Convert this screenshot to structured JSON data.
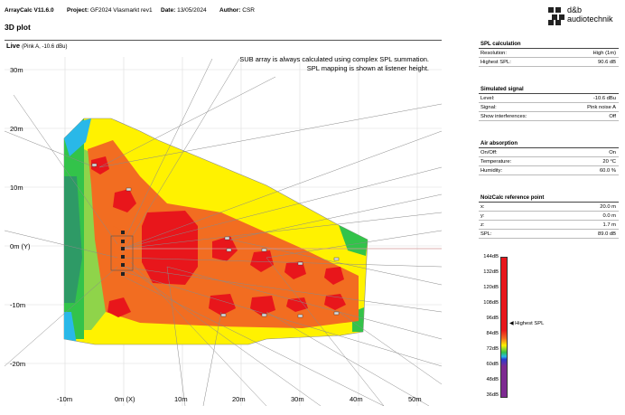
{
  "header": {
    "app": "ArrayCalc V11.6.0",
    "project_label": "Project:",
    "project": "GF2024 Vlasmarkt rev1",
    "date_label": "Date:",
    "date": "13/05/2024",
    "author_label": "Author:",
    "author": "CSR",
    "logo_line1": "d&b",
    "logo_line2": "audiotechnik"
  },
  "plot": {
    "title": "3D plot",
    "live_label": "Live",
    "live_sub": "(Pink A, -10.6 dBu)",
    "note_line1": "SUB array is always calculated using complex SPL summation.",
    "note_line2": "SPL mapping is shown at listener height.",
    "y_ticks": [
      "30m",
      "20m",
      "10m",
      "0m (Y)",
      "-10m",
      "-20m"
    ],
    "x_ticks": [
      "-10m",
      "0m (X)",
      "10m",
      "20m",
      "30m",
      "40m",
      "50m"
    ]
  },
  "panels": [
    {
      "title": "SPL calculation",
      "rows": [
        {
          "label": "Resolution:",
          "value": "High (1m)"
        },
        {
          "label": "Highest SPL:",
          "value": "90.6 dB"
        }
      ]
    },
    {
      "title": "Simulated signal",
      "rows": [
        {
          "label": "Level:",
          "value": "-10.6 dBu"
        },
        {
          "label": "Signal:",
          "value": "Pink noise A"
        },
        {
          "label": "Show interferences:",
          "value": "Off"
        }
      ]
    },
    {
      "title": "Air absorption",
      "rows": [
        {
          "label": "On/Off:",
          "value": "On"
        },
        {
          "label": "Temperature:",
          "value": "20 °C"
        },
        {
          "label": "Humidity:",
          "value": "60.0 %"
        }
      ]
    },
    {
      "title": "NoizCalc reference point",
      "rows": [
        {
          "label": "x:",
          "value": "20.0 m"
        },
        {
          "label": "y:",
          "value": "0.0 m"
        },
        {
          "label": "z:",
          "value": "1.7 m"
        },
        {
          "label": "SPL:",
          "value": "89.0 dB"
        }
      ]
    }
  ],
  "scale": {
    "ticks": [
      "144dB",
      "132dB",
      "120dB",
      "108dB",
      "96dB",
      "84dB",
      "72dB",
      "60dB",
      "48dB",
      "36dB"
    ],
    "highest_label": "Highest SPL",
    "colors": {
      "red": "#e8161b",
      "orange": "#f26d21",
      "yellow": "#fff200",
      "green": "#33c34a",
      "cyan": "#29b8e8",
      "blue": "#2b3bd1",
      "purple": "#7d2a91"
    }
  }
}
